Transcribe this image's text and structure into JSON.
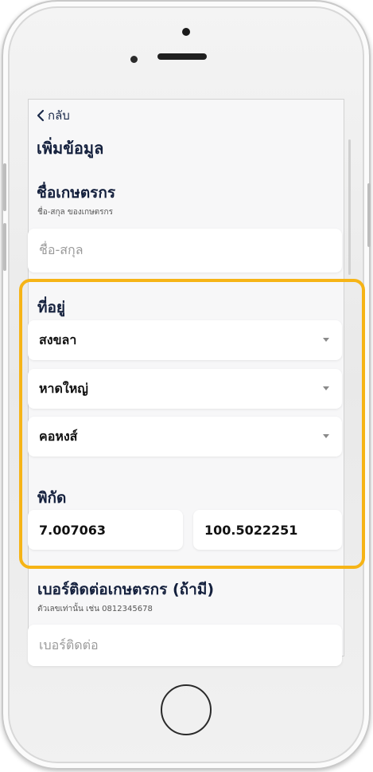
{
  "nav": {
    "back_label": "กลับ"
  },
  "page_title": "เพิ่มข้อมูล",
  "farmer_name": {
    "label": "ชื่อเกษตรกร",
    "hint": "ชื่อ-สกุล ของเกษตรกร",
    "placeholder": "ชื่อ-สกุล"
  },
  "address": {
    "label": "ที่อยู่",
    "province": "สงขลา",
    "district": "หาดใหญ่",
    "subdistrict": "คอหงส์"
  },
  "coordinates": {
    "label": "พิกัด",
    "latitude": "7.007063",
    "longitude": "100.5022251"
  },
  "phone": {
    "label": "เบอร์ติดต่อเกษตรกร (ถ้ามี)",
    "hint": "ตัวเลขเท่านั้น เช่น 0812345678",
    "placeholder": "เบอร์ติดต่อ"
  },
  "colors": {
    "highlight": "#f6b416",
    "text_primary": "#14203d",
    "field_background": "#ffffff",
    "screen_background": "#f7f7f8"
  },
  "icons": {
    "back": "chevron-left-icon",
    "dropdown": "caret-down-icon"
  }
}
